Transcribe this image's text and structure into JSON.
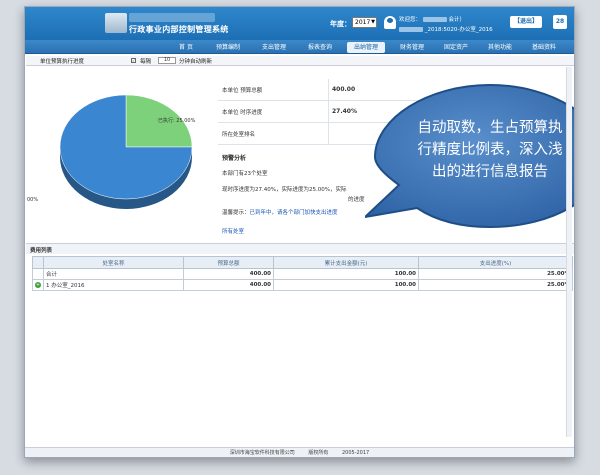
{
  "header": {
    "app_title": "行政事业内部控制管理系统",
    "year_label": "年度：",
    "year_value": "2017",
    "welcome": "欢迎您：",
    "welcome_suffix": "会计）",
    "user_line": "_2018:5020-办公室_2016",
    "logout_label": "【退出】",
    "badge_count": "28"
  },
  "nav": {
    "items": [
      {
        "label": "首  页"
      },
      {
        "label": "预算编制"
      },
      {
        "label": "支出管理"
      },
      {
        "label": "报表查询"
      },
      {
        "label": "出纳管理"
      },
      {
        "label": "财务管理"
      },
      {
        "label": "固定资产"
      },
      {
        "label": "其他功能"
      },
      {
        "label": "基础资料"
      }
    ],
    "active_index": 4
  },
  "toolbar": {
    "label": "单位预算执行进度",
    "checkbox_mark": "✓",
    "every_label": "每隔",
    "interval_value": "10",
    "suffix_label": "分钟自动刷新"
  },
  "chart_data": {
    "type": "pie",
    "slices": [
      {
        "label": "已执行: 25.00%",
        "value": 25.0,
        "color": "#7dd17a"
      },
      {
        "label": "00%",
        "value": 75.0,
        "color": "#3b86d0"
      }
    ]
  },
  "info": {
    "rows": [
      {
        "key": "本单位 预算总额",
        "value": "400.00"
      },
      {
        "key": "本单位 时序进度",
        "value": "27.40%"
      },
      {
        "key": "所在处室排名",
        "value": ""
      }
    ],
    "analysis_title": "预警分析",
    "analysis_lines": [
      "本部门有23个处室",
      "现时序进度为27.40%，实际进度为25.00%，实际",
      "的进度"
    ],
    "alert_prefix": "温馨提示：",
    "alert_text": "已到年中，请各个部门加快支出进度",
    "all_link": "所有处室"
  },
  "callout": {
    "lines": [
      "自动取数，生占预算执",
      "行精度比例表，深入浅",
      "出的进行信息报告"
    ]
  },
  "cost_table": {
    "title": "费用列表",
    "headers": [
      "处室名称",
      "预算总额",
      "累计支出金额(元)",
      "支出进度(%)"
    ],
    "rows": [
      {
        "idx": "",
        "name": "合计",
        "budget": "400.00",
        "spent": "100.00",
        "progress": "25.00%"
      },
      {
        "idx": "1",
        "name": "办公室_2016",
        "budget": "400.00",
        "spent": "100.00",
        "progress": "25.00%"
      }
    ],
    "row_icon": "+"
  },
  "footer": {
    "company": "深圳市海宝软件科技有限公司",
    "rights": "版权所有",
    "years": "2005-2017"
  }
}
